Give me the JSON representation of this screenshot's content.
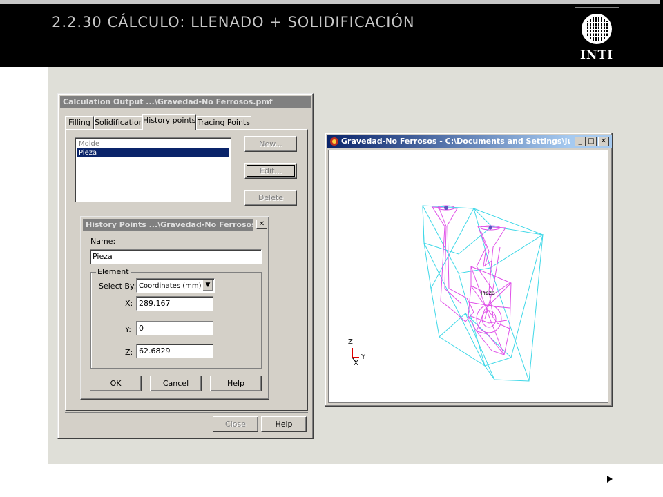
{
  "slide": {
    "title": "2.2.30 CÁLCULO: LLENADO + SOLIDIFICACIÓN",
    "logo_text": "INTI"
  },
  "calc_window": {
    "title": "Calculation Output ...\\Gravedad-No Ferrosos.pmf",
    "tabs": [
      {
        "label": "Filling"
      },
      {
        "label": "Solidification"
      },
      {
        "label": "History points",
        "active": true
      },
      {
        "label": "Tracing Points"
      }
    ],
    "list_items": [
      {
        "label": "Molde"
      },
      {
        "label": "Pieza",
        "selected": true
      }
    ],
    "buttons": {
      "new": "New...",
      "edit": "Edit...",
      "delete": "Delete"
    },
    "footer_buttons": {
      "close": "Close",
      "help": "Help"
    }
  },
  "history_dialog": {
    "title": "History Points ...\\Gravedad-No Ferrosos.pmf",
    "close_glyph": "✕",
    "name_label": "Name:",
    "name_value": "Pieza",
    "group_label": "Element",
    "select_by_label": "Select By:",
    "select_by_value": "Coordinates (mm)",
    "dropdown_glyph": "▼",
    "x_label": "X:",
    "x_value": "289.167",
    "y_label": "Y:",
    "y_value": "0",
    "z_label": "Z:",
    "z_value": "62.6829",
    "buttons": {
      "ok": "OK",
      "cancel": "Cancel",
      "help": "Help"
    }
  },
  "viewer_window": {
    "title": "Gravedad-No Ferrosos - C:\\Documents and Settings\\Juan...",
    "caption_buttons": {
      "minimize": "_",
      "maximize": "□",
      "close": "✕"
    },
    "axis_labels": {
      "z": "Z",
      "y": "Y",
      "x": "X"
    },
    "part_label": "Pieza",
    "colors": {
      "mold": "#40d8e8",
      "part": "#e050e8",
      "axis_red": "#e00000"
    }
  }
}
